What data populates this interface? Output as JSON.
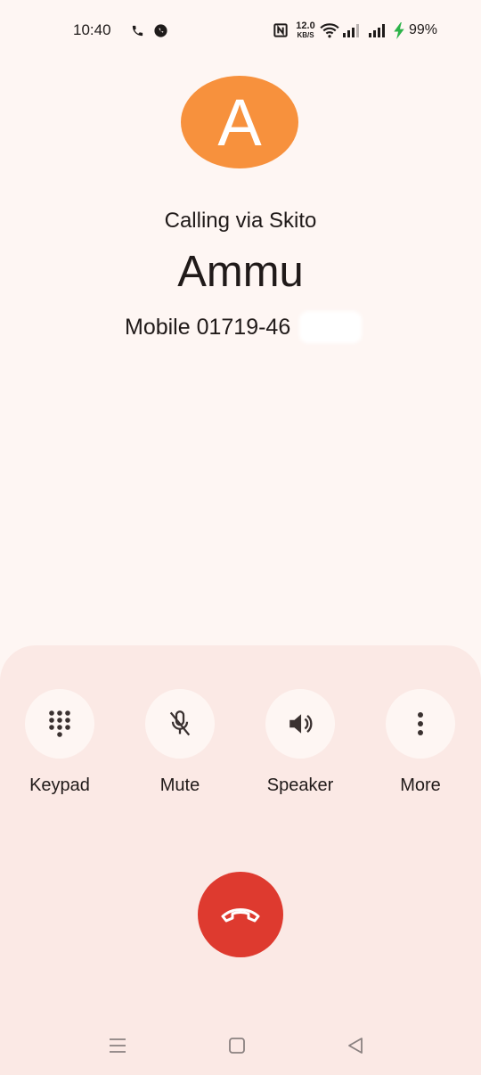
{
  "status_bar": {
    "time": "10:40",
    "net_speed_value": "12.0",
    "net_speed_unit": "KB/S",
    "battery": "99%",
    "icons": [
      "phone-icon",
      "whatsapp-icon",
      "nfc-icon",
      "wifi-icon",
      "signal-icon",
      "signal-icon",
      "charging-icon"
    ]
  },
  "caller": {
    "avatar_letter": "A",
    "avatar_color": "#f7913d",
    "calling_via": "Calling via Skito",
    "name": "Ammu",
    "number": "Mobile 01719-46"
  },
  "controls": [
    {
      "label": "Keypad",
      "icon": "dialpad-icon"
    },
    {
      "label": "Mute",
      "icon": "mic-off-icon"
    },
    {
      "label": "Speaker",
      "icon": "speaker-icon"
    },
    {
      "label": "More",
      "icon": "more-vertical-icon"
    }
  ],
  "end_call": {
    "icon": "hang-up-icon",
    "color": "#de3a2f"
  },
  "nav": {
    "icons": [
      "menu-icon",
      "home-icon",
      "back-icon"
    ]
  }
}
